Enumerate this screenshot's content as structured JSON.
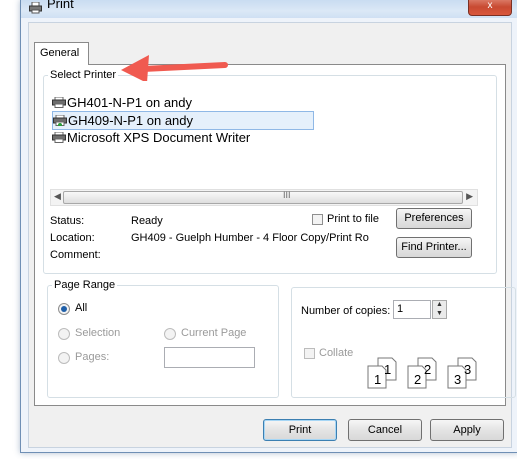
{
  "window": {
    "title": "Print",
    "close_glyph": "x"
  },
  "tabs": [
    {
      "label": "General"
    }
  ],
  "select_printer": {
    "legend": "Select Printer",
    "printers": [
      {
        "name": "GH401-N-P1 on andy",
        "selected": false,
        "icon": "printer-icon"
      },
      {
        "name": "GH409-N-P1 on andy",
        "selected": true,
        "icon": "printer-icon"
      },
      {
        "name": "Microsoft XPS Document Writer",
        "selected": false,
        "icon": "printer-icon"
      }
    ],
    "scroll_grip": "III",
    "status_label": "Status:",
    "status_value": "Ready",
    "location_label": "Location:",
    "location_value": "GH409 - Guelph Humber - 4 Floor Copy/Print Ro",
    "comment_label": "Comment:",
    "comment_value": "",
    "print_to_file_label": "Print to file",
    "print_to_file_checked": false,
    "preferences_label": "Preferences",
    "find_printer_label": "Find Printer..."
  },
  "annotation": {
    "arrow_color": "#f05a50"
  },
  "page_range": {
    "legend": "Page Range",
    "all_label": "All",
    "selection_label": "Selection",
    "current_page_label": "Current Page",
    "pages_label": "Pages:",
    "pages_value": "",
    "selected": "All"
  },
  "copies": {
    "number_label": "Number of copies:",
    "number_value": "1",
    "collate_label": "Collate",
    "collate_checked": false,
    "collate_pages": [
      "1",
      "1",
      "2",
      "2",
      "3",
      "3"
    ]
  },
  "footer": {
    "print_label": "Print",
    "cancel_label": "Cancel",
    "apply_label": "Apply"
  }
}
